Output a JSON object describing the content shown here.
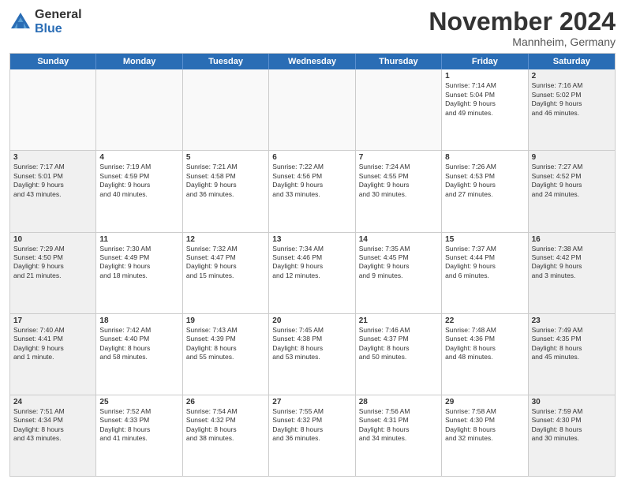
{
  "logo": {
    "general": "General",
    "blue": "Blue"
  },
  "title": "November 2024",
  "location": "Mannheim, Germany",
  "days_of_week": [
    "Sunday",
    "Monday",
    "Tuesday",
    "Wednesday",
    "Thursday",
    "Friday",
    "Saturday"
  ],
  "rows": [
    [
      {
        "day": "",
        "info": "",
        "empty": true
      },
      {
        "day": "",
        "info": "",
        "empty": true
      },
      {
        "day": "",
        "info": "",
        "empty": true
      },
      {
        "day": "",
        "info": "",
        "empty": true
      },
      {
        "day": "",
        "info": "",
        "empty": true
      },
      {
        "day": "1",
        "info": "Sunrise: 7:14 AM\nSunset: 5:04 PM\nDaylight: 9 hours\nand 49 minutes."
      },
      {
        "day": "2",
        "info": "Sunrise: 7:16 AM\nSunset: 5:02 PM\nDaylight: 9 hours\nand 46 minutes."
      }
    ],
    [
      {
        "day": "3",
        "info": "Sunrise: 7:17 AM\nSunset: 5:01 PM\nDaylight: 9 hours\nand 43 minutes."
      },
      {
        "day": "4",
        "info": "Sunrise: 7:19 AM\nSunset: 4:59 PM\nDaylight: 9 hours\nand 40 minutes."
      },
      {
        "day": "5",
        "info": "Sunrise: 7:21 AM\nSunset: 4:58 PM\nDaylight: 9 hours\nand 36 minutes."
      },
      {
        "day": "6",
        "info": "Sunrise: 7:22 AM\nSunset: 4:56 PM\nDaylight: 9 hours\nand 33 minutes."
      },
      {
        "day": "7",
        "info": "Sunrise: 7:24 AM\nSunset: 4:55 PM\nDaylight: 9 hours\nand 30 minutes."
      },
      {
        "day": "8",
        "info": "Sunrise: 7:26 AM\nSunset: 4:53 PM\nDaylight: 9 hours\nand 27 minutes."
      },
      {
        "day": "9",
        "info": "Sunrise: 7:27 AM\nSunset: 4:52 PM\nDaylight: 9 hours\nand 24 minutes."
      }
    ],
    [
      {
        "day": "10",
        "info": "Sunrise: 7:29 AM\nSunset: 4:50 PM\nDaylight: 9 hours\nand 21 minutes."
      },
      {
        "day": "11",
        "info": "Sunrise: 7:30 AM\nSunset: 4:49 PM\nDaylight: 9 hours\nand 18 minutes."
      },
      {
        "day": "12",
        "info": "Sunrise: 7:32 AM\nSunset: 4:47 PM\nDaylight: 9 hours\nand 15 minutes."
      },
      {
        "day": "13",
        "info": "Sunrise: 7:34 AM\nSunset: 4:46 PM\nDaylight: 9 hours\nand 12 minutes."
      },
      {
        "day": "14",
        "info": "Sunrise: 7:35 AM\nSunset: 4:45 PM\nDaylight: 9 hours\nand 9 minutes."
      },
      {
        "day": "15",
        "info": "Sunrise: 7:37 AM\nSunset: 4:44 PM\nDaylight: 9 hours\nand 6 minutes."
      },
      {
        "day": "16",
        "info": "Sunrise: 7:38 AM\nSunset: 4:42 PM\nDaylight: 9 hours\nand 3 minutes."
      }
    ],
    [
      {
        "day": "17",
        "info": "Sunrise: 7:40 AM\nSunset: 4:41 PM\nDaylight: 9 hours\nand 1 minute."
      },
      {
        "day": "18",
        "info": "Sunrise: 7:42 AM\nSunset: 4:40 PM\nDaylight: 8 hours\nand 58 minutes."
      },
      {
        "day": "19",
        "info": "Sunrise: 7:43 AM\nSunset: 4:39 PM\nDaylight: 8 hours\nand 55 minutes."
      },
      {
        "day": "20",
        "info": "Sunrise: 7:45 AM\nSunset: 4:38 PM\nDaylight: 8 hours\nand 53 minutes."
      },
      {
        "day": "21",
        "info": "Sunrise: 7:46 AM\nSunset: 4:37 PM\nDaylight: 8 hours\nand 50 minutes."
      },
      {
        "day": "22",
        "info": "Sunrise: 7:48 AM\nSunset: 4:36 PM\nDaylight: 8 hours\nand 48 minutes."
      },
      {
        "day": "23",
        "info": "Sunrise: 7:49 AM\nSunset: 4:35 PM\nDaylight: 8 hours\nand 45 minutes."
      }
    ],
    [
      {
        "day": "24",
        "info": "Sunrise: 7:51 AM\nSunset: 4:34 PM\nDaylight: 8 hours\nand 43 minutes."
      },
      {
        "day": "25",
        "info": "Sunrise: 7:52 AM\nSunset: 4:33 PM\nDaylight: 8 hours\nand 41 minutes."
      },
      {
        "day": "26",
        "info": "Sunrise: 7:54 AM\nSunset: 4:32 PM\nDaylight: 8 hours\nand 38 minutes."
      },
      {
        "day": "27",
        "info": "Sunrise: 7:55 AM\nSunset: 4:32 PM\nDaylight: 8 hours\nand 36 minutes."
      },
      {
        "day": "28",
        "info": "Sunrise: 7:56 AM\nSunset: 4:31 PM\nDaylight: 8 hours\nand 34 minutes."
      },
      {
        "day": "29",
        "info": "Sunrise: 7:58 AM\nSunset: 4:30 PM\nDaylight: 8 hours\nand 32 minutes."
      },
      {
        "day": "30",
        "info": "Sunrise: 7:59 AM\nSunset: 4:30 PM\nDaylight: 8 hours\nand 30 minutes."
      }
    ]
  ]
}
